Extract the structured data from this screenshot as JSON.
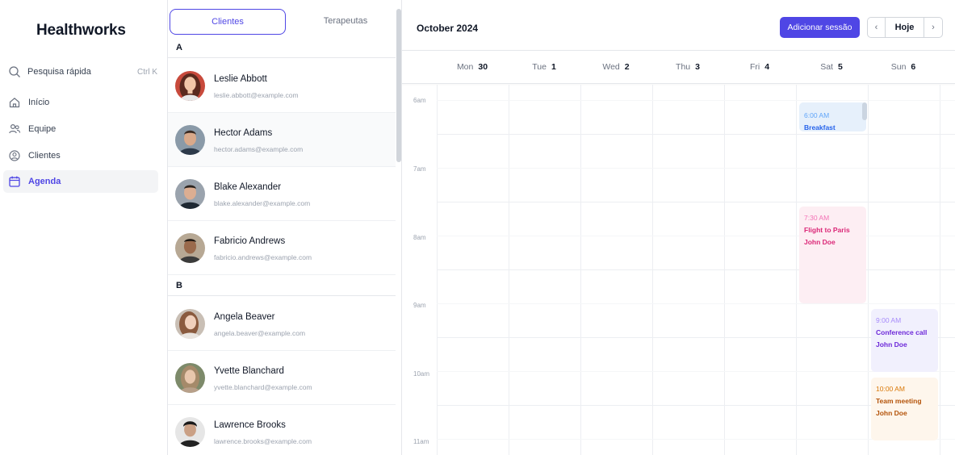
{
  "sidebar": {
    "brand": "Healthworks",
    "search": {
      "label": "Pesquisa rápida",
      "shortcut": "Ctrl K",
      "icon": "search-icon"
    },
    "items": [
      {
        "label": "Início",
        "icon": "home-icon",
        "active": false
      },
      {
        "label": "Equipe",
        "icon": "team-icon",
        "active": false
      },
      {
        "label": "Clientes",
        "icon": "user-circle-icon",
        "active": false
      },
      {
        "label": "Agenda",
        "icon": "calendar-icon",
        "active": true
      }
    ],
    "accent": "#4f46e5"
  },
  "list": {
    "tabs": [
      {
        "label": "Clientes",
        "active": true
      },
      {
        "label": "Terapeutas",
        "active": false
      }
    ],
    "groups": [
      {
        "letter": "A",
        "clients": [
          {
            "name": "Leslie Abbott",
            "email": "leslie.abbott@example.com"
          },
          {
            "name": "Hector Adams",
            "email": "hector.adams@example.com"
          },
          {
            "name": "Blake Alexander",
            "email": "blake.alexander@example.com"
          },
          {
            "name": "Fabricio Andrews",
            "email": "fabricio.andrews@example.com"
          }
        ]
      },
      {
        "letter": "B",
        "clients": [
          {
            "name": "Angela Beaver",
            "email": "angela.beaver@example.com"
          },
          {
            "name": "Yvette Blanchard",
            "email": "yvette.blanchard@example.com"
          },
          {
            "name": "Lawrence Brooks",
            "email": "lawrence.brooks@example.com"
          }
        ]
      }
    ]
  },
  "calendar": {
    "title": "October 2024",
    "add_button": "Adicionar sessão",
    "today_button": "Hoje",
    "prev_icon": "chevron-left-icon",
    "next_icon": "chevron-right-icon",
    "days": [
      {
        "name": "Mon",
        "date": "30"
      },
      {
        "name": "Tue",
        "date": "1"
      },
      {
        "name": "Wed",
        "date": "2"
      },
      {
        "name": "Thu",
        "date": "3"
      },
      {
        "name": "Fri",
        "date": "4"
      },
      {
        "name": "Sat",
        "date": "5"
      },
      {
        "name": "Sun",
        "date": "6"
      }
    ],
    "hours": [
      "6am",
      "7am",
      "8am",
      "9am",
      "10am",
      "11am"
    ],
    "events": [
      {
        "time": "6:00 AM",
        "title": "Breakfast",
        "person": "",
        "day": "Sat",
        "color": "#e6f0fb"
      },
      {
        "time": "7:30 AM",
        "title": "Flight to Paris",
        "person": "John Doe",
        "day": "Sat",
        "color": "#fdeef3"
      },
      {
        "time": "9:00 AM",
        "title": "Conference call",
        "person": "John Doe",
        "day": "Sun",
        "color": "#f1f0fd"
      },
      {
        "time": "10:00 AM",
        "title": "Team meeting",
        "person": "John Doe",
        "day": "Sun",
        "color": "#fef6ec"
      }
    ]
  }
}
